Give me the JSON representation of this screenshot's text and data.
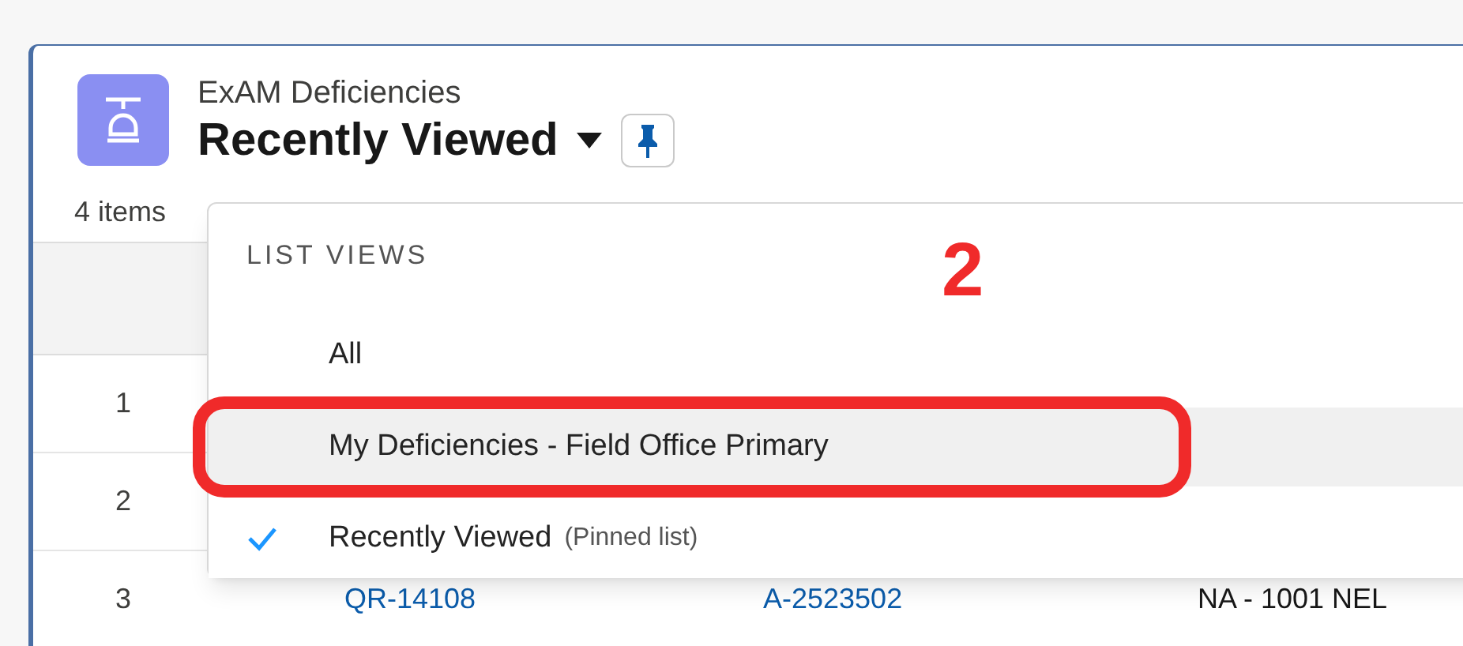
{
  "header": {
    "object_name": "ExAM Deficiencies",
    "list_view": "Recently Viewed",
    "pinned": true
  },
  "item_count": "4 items",
  "rows": [
    {
      "number": "1"
    },
    {
      "number": "2"
    },
    {
      "number": "3",
      "column_1": "QR-14108",
      "column_2": "A-2523502",
      "column_3": "NA - 1001 NEL"
    }
  ],
  "dropdown": {
    "heading": "LIST VIEWS",
    "items": [
      {
        "label": "All",
        "selected": false,
        "highlighted": false,
        "circled": false
      },
      {
        "label": "My Deficiencies - Field Office Primary",
        "selected": false,
        "highlighted": true,
        "circled": true
      },
      {
        "label": "Recently Viewed",
        "note": "(Pinned list)",
        "selected": true,
        "highlighted": false,
        "circled": false
      }
    ]
  },
  "annotation": {
    "number": "2"
  }
}
